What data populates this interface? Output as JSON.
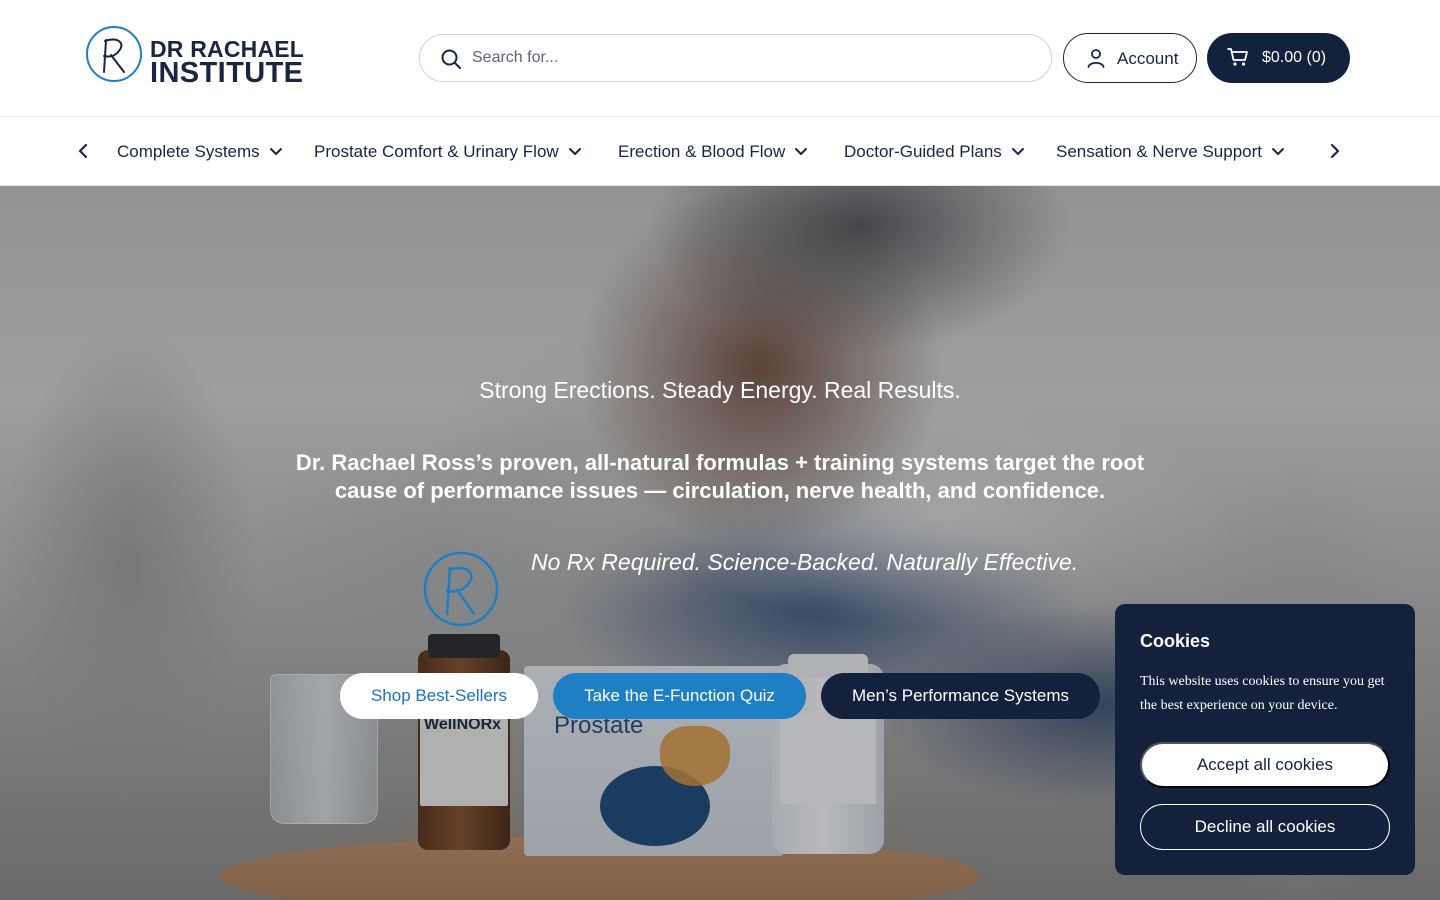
{
  "brand": {
    "name_line1": "DR RACHAEL",
    "name_line2": "INSTITUTE",
    "primary_color": "#14213d",
    "accent_color": "#1f7fc4"
  },
  "header": {
    "search": {
      "placeholder": "Search for...",
      "icon": "search-icon"
    },
    "account": {
      "label": "Account",
      "icon": "user-icon"
    },
    "cart": {
      "label": "$0.00 (0)",
      "icon": "cart-icon"
    }
  },
  "nav": {
    "prev_icon": "chevron-left-icon",
    "next_icon": "chevron-right-icon",
    "items": [
      {
        "label": "Complete Systems"
      },
      {
        "label": "Prostate Comfort & Urinary Flow"
      },
      {
        "label": "Erection & Blood Flow"
      },
      {
        "label": "Doctor-Guided Plans"
      },
      {
        "label": "Sensation & Nerve Support"
      }
    ]
  },
  "hero": {
    "eyebrow": "Strong Erections. Steady Energy. Real Results.",
    "headline": "Dr. Rachael Ross’s proven, all-natural formulas + training systems target the root cause of performance issues — circulation, nerve health, and confidence.",
    "tagline": "No Rx Required. Science-Backed. Naturally Effective.",
    "products": {
      "bottle_label": "WellNORx",
      "box_label": "Prostate"
    },
    "buttons": {
      "shop": "Shop Best-Sellers",
      "quiz": "Take the E-Function Quiz",
      "systems": "Men’s Performance Systems"
    }
  },
  "cookies": {
    "title": "Cookies",
    "text": "This website uses cookies to ensure you get the best experience on your device.",
    "accept": "Accept all cookies",
    "decline": "Decline all cookies"
  }
}
